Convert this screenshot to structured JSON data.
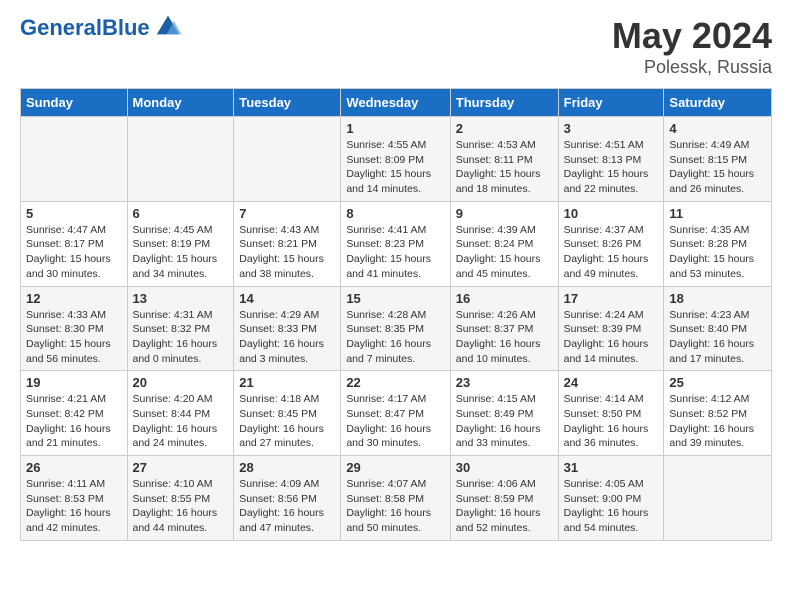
{
  "logo": {
    "text_general": "General",
    "text_blue": "Blue"
  },
  "header": {
    "title": "May 2024",
    "subtitle": "Polessk, Russia"
  },
  "weekdays": [
    "Sunday",
    "Monday",
    "Tuesday",
    "Wednesday",
    "Thursday",
    "Friday",
    "Saturday"
  ],
  "weeks": [
    [
      {
        "num": "",
        "info": ""
      },
      {
        "num": "",
        "info": ""
      },
      {
        "num": "",
        "info": ""
      },
      {
        "num": "1",
        "info": "Sunrise: 4:55 AM\nSunset: 8:09 PM\nDaylight: 15 hours\nand 14 minutes."
      },
      {
        "num": "2",
        "info": "Sunrise: 4:53 AM\nSunset: 8:11 PM\nDaylight: 15 hours\nand 18 minutes."
      },
      {
        "num": "3",
        "info": "Sunrise: 4:51 AM\nSunset: 8:13 PM\nDaylight: 15 hours\nand 22 minutes."
      },
      {
        "num": "4",
        "info": "Sunrise: 4:49 AM\nSunset: 8:15 PM\nDaylight: 15 hours\nand 26 minutes."
      }
    ],
    [
      {
        "num": "5",
        "info": "Sunrise: 4:47 AM\nSunset: 8:17 PM\nDaylight: 15 hours\nand 30 minutes."
      },
      {
        "num": "6",
        "info": "Sunrise: 4:45 AM\nSunset: 8:19 PM\nDaylight: 15 hours\nand 34 minutes."
      },
      {
        "num": "7",
        "info": "Sunrise: 4:43 AM\nSunset: 8:21 PM\nDaylight: 15 hours\nand 38 minutes."
      },
      {
        "num": "8",
        "info": "Sunrise: 4:41 AM\nSunset: 8:23 PM\nDaylight: 15 hours\nand 41 minutes."
      },
      {
        "num": "9",
        "info": "Sunrise: 4:39 AM\nSunset: 8:24 PM\nDaylight: 15 hours\nand 45 minutes."
      },
      {
        "num": "10",
        "info": "Sunrise: 4:37 AM\nSunset: 8:26 PM\nDaylight: 15 hours\nand 49 minutes."
      },
      {
        "num": "11",
        "info": "Sunrise: 4:35 AM\nSunset: 8:28 PM\nDaylight: 15 hours\nand 53 minutes."
      }
    ],
    [
      {
        "num": "12",
        "info": "Sunrise: 4:33 AM\nSunset: 8:30 PM\nDaylight: 15 hours\nand 56 minutes."
      },
      {
        "num": "13",
        "info": "Sunrise: 4:31 AM\nSunset: 8:32 PM\nDaylight: 16 hours\nand 0 minutes."
      },
      {
        "num": "14",
        "info": "Sunrise: 4:29 AM\nSunset: 8:33 PM\nDaylight: 16 hours\nand 3 minutes."
      },
      {
        "num": "15",
        "info": "Sunrise: 4:28 AM\nSunset: 8:35 PM\nDaylight: 16 hours\nand 7 minutes."
      },
      {
        "num": "16",
        "info": "Sunrise: 4:26 AM\nSunset: 8:37 PM\nDaylight: 16 hours\nand 10 minutes."
      },
      {
        "num": "17",
        "info": "Sunrise: 4:24 AM\nSunset: 8:39 PM\nDaylight: 16 hours\nand 14 minutes."
      },
      {
        "num": "18",
        "info": "Sunrise: 4:23 AM\nSunset: 8:40 PM\nDaylight: 16 hours\nand 17 minutes."
      }
    ],
    [
      {
        "num": "19",
        "info": "Sunrise: 4:21 AM\nSunset: 8:42 PM\nDaylight: 16 hours\nand 21 minutes."
      },
      {
        "num": "20",
        "info": "Sunrise: 4:20 AM\nSunset: 8:44 PM\nDaylight: 16 hours\nand 24 minutes."
      },
      {
        "num": "21",
        "info": "Sunrise: 4:18 AM\nSunset: 8:45 PM\nDaylight: 16 hours\nand 27 minutes."
      },
      {
        "num": "22",
        "info": "Sunrise: 4:17 AM\nSunset: 8:47 PM\nDaylight: 16 hours\nand 30 minutes."
      },
      {
        "num": "23",
        "info": "Sunrise: 4:15 AM\nSunset: 8:49 PM\nDaylight: 16 hours\nand 33 minutes."
      },
      {
        "num": "24",
        "info": "Sunrise: 4:14 AM\nSunset: 8:50 PM\nDaylight: 16 hours\nand 36 minutes."
      },
      {
        "num": "25",
        "info": "Sunrise: 4:12 AM\nSunset: 8:52 PM\nDaylight: 16 hours\nand 39 minutes."
      }
    ],
    [
      {
        "num": "26",
        "info": "Sunrise: 4:11 AM\nSunset: 8:53 PM\nDaylight: 16 hours\nand 42 minutes."
      },
      {
        "num": "27",
        "info": "Sunrise: 4:10 AM\nSunset: 8:55 PM\nDaylight: 16 hours\nand 44 minutes."
      },
      {
        "num": "28",
        "info": "Sunrise: 4:09 AM\nSunset: 8:56 PM\nDaylight: 16 hours\nand 47 minutes."
      },
      {
        "num": "29",
        "info": "Sunrise: 4:07 AM\nSunset: 8:58 PM\nDaylight: 16 hours\nand 50 minutes."
      },
      {
        "num": "30",
        "info": "Sunrise: 4:06 AM\nSunset: 8:59 PM\nDaylight: 16 hours\nand 52 minutes."
      },
      {
        "num": "31",
        "info": "Sunrise: 4:05 AM\nSunset: 9:00 PM\nDaylight: 16 hours\nand 54 minutes."
      },
      {
        "num": "",
        "info": ""
      }
    ]
  ]
}
